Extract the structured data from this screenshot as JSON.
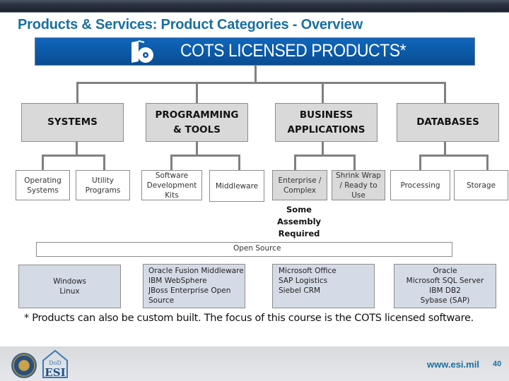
{
  "slide": {
    "title": "Products & Services: Product Categories - Overview",
    "page_number": "40",
    "url": "www.esi.mil"
  },
  "banner": {
    "title": "COTS LICENSED PRODUCTS*",
    "icon": "software-box-cd-icon"
  },
  "categories": [
    {
      "label": "SYSTEMS",
      "subs": [
        "Operating Systems",
        "Utility Programs"
      ]
    },
    {
      "label": "PROGRAMMING & TOOLS",
      "subs": [
        "Software Development Kits",
        "Middleware"
      ]
    },
    {
      "label": "BUSINESS APPLICATIONS",
      "subs": [
        "Enterprise / Complex",
        "Shrink Wrap / Ready to Use"
      ]
    },
    {
      "label": "DATABASES",
      "subs": [
        "Processing",
        "Storage"
      ]
    }
  ],
  "cat_lines": {
    "programming": [
      "PROGRAMMING",
      "& TOOLS"
    ],
    "business": [
      "BUSINESS",
      "APPLICATIONS"
    ]
  },
  "sub_lines": {
    "operating": [
      "Operating",
      "Systems"
    ],
    "utility": [
      "Utility",
      "Programs"
    ],
    "sdk": [
      "Software",
      "Development",
      "Kits"
    ],
    "enterprise": [
      "Enterprise /",
      "Complex"
    ],
    "shrink": [
      "Shrink Wrap",
      "/ Ready to",
      "Use"
    ]
  },
  "assembly_note": [
    "Some",
    "Assembly",
    "Required"
  ],
  "open_source_label": "Open Source",
  "examples": {
    "systems": [
      "Windows",
      "Linux"
    ],
    "programming": [
      "Oracle Fusion Middleware",
      "IBM WebSphere",
      "JBoss Enterprise Open",
      "Source"
    ],
    "business": [
      "Microsoft Office",
      "SAP Logistics",
      "Siebel CRM"
    ],
    "databases": [
      "Oracle",
      "Microsoft SQL Server",
      "IBM DB2",
      "Sybase (SAP)"
    ]
  },
  "footnote": "* Products can also be custom built. The focus of this course is the COTS licensed software.",
  "logos": [
    "dod-seal",
    "dod-esi-logo"
  ]
}
